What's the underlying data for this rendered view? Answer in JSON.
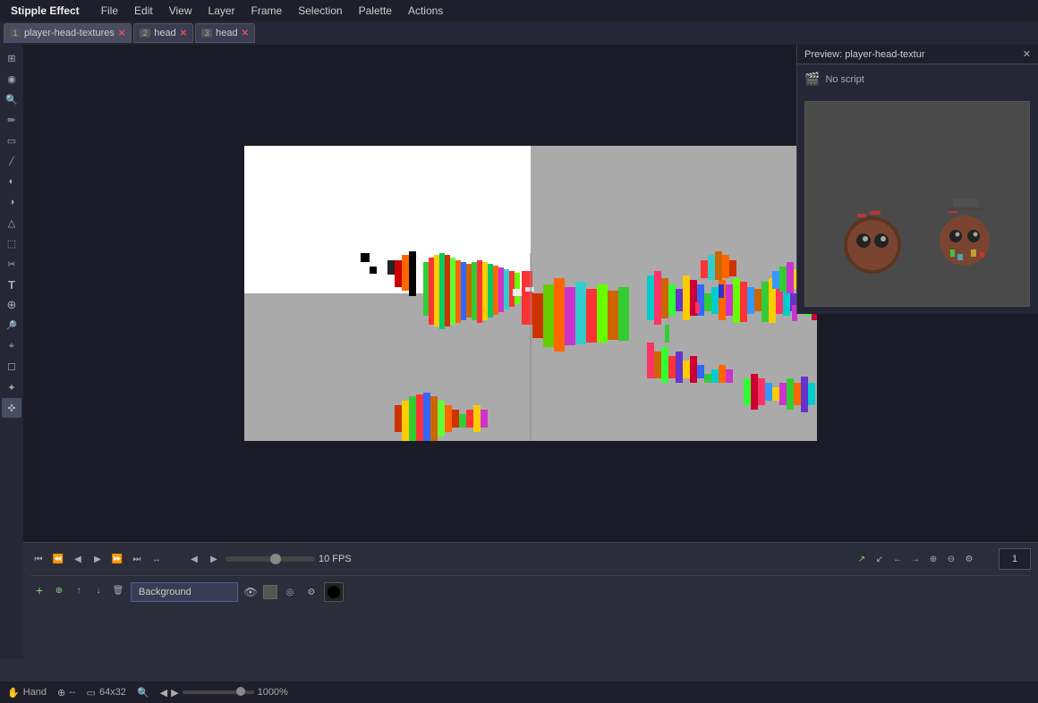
{
  "app": {
    "title": "Stipple Effect"
  },
  "menubar": {
    "items": [
      "Stipple Effect",
      "File",
      "Edit",
      "View",
      "Layer",
      "Frame",
      "Selection",
      "Palette",
      "Actions"
    ]
  },
  "tabs": [
    {
      "num": "1",
      "label": "player-head-textures",
      "active": true
    },
    {
      "num": "2",
      "label": "head",
      "active": false
    },
    {
      "num": "3",
      "label": "head",
      "active": false
    }
  ],
  "tools": [
    {
      "icon": "⊞",
      "name": "grid-tool"
    },
    {
      "icon": "◉",
      "name": "circle-tool"
    },
    {
      "icon": "🔍",
      "name": "zoom-tool"
    },
    {
      "icon": "✏",
      "name": "pencil-tool"
    },
    {
      "icon": "▬",
      "name": "line-tool"
    },
    {
      "icon": "◫",
      "name": "brush-tool"
    },
    {
      "icon": "◐",
      "name": "shade-tool"
    },
    {
      "icon": "▲",
      "name": "shape-tool"
    },
    {
      "icon": "⬚",
      "name": "select-tool"
    },
    {
      "icon": "✂",
      "name": "cut-tool"
    },
    {
      "icon": "T",
      "name": "text-tool"
    },
    {
      "icon": "⊕",
      "name": "fill-tool"
    },
    {
      "icon": "🔎",
      "name": "eyedropper-tool"
    },
    {
      "icon": "⌖",
      "name": "transform-tool"
    },
    {
      "icon": "☐",
      "name": "crop-tool"
    },
    {
      "icon": "✦",
      "name": "wand-tool"
    },
    {
      "icon": "✜",
      "name": "move-tool"
    }
  ],
  "timeline": {
    "fps": "10 FPS",
    "frame_num": "1",
    "controls": [
      "⏮",
      "⏪",
      "◀",
      "▶",
      "⏩",
      "⏭",
      "↔"
    ],
    "frame_controls": [
      "↗",
      "↙",
      "←",
      "→",
      "⊕",
      "⊖",
      "⚙"
    ]
  },
  "layer": {
    "name": "Background",
    "controls_top": [
      "+",
      "⊕",
      "↑",
      "↓",
      "🗑"
    ],
    "icon_buttons": [
      "👁",
      "▬",
      "◎",
      "⚙"
    ]
  },
  "preview": {
    "title": "Preview: player-head-textur",
    "script_label": "No script"
  },
  "statusbar": {
    "tool": "Hand",
    "cursor_pos": "--",
    "dimensions": "64x32",
    "zoom_pct": "1000%"
  }
}
